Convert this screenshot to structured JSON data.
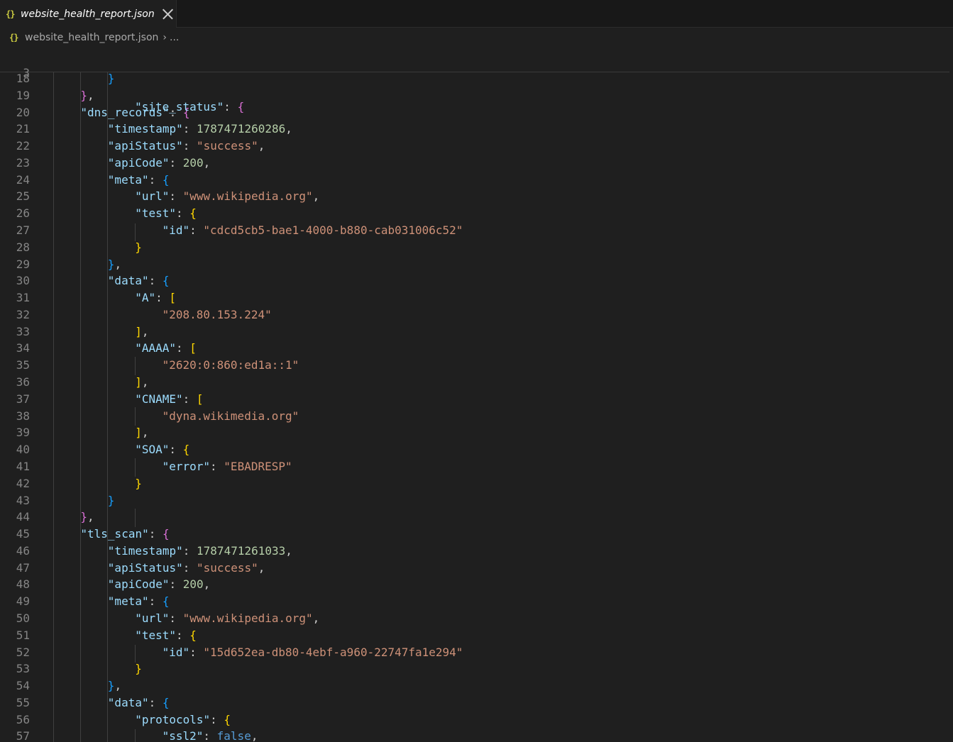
{
  "tab": {
    "filename": "website_health_report.json",
    "icon": "json-braces-icon"
  },
  "breadcrumb": {
    "file": "website_health_report.json",
    "sep": "›",
    "more": "..."
  },
  "sticky_line": {
    "number": "3",
    "key": "\"site_status\"",
    "brace": "{"
  },
  "colors": {
    "key": "#9cdcfe",
    "string": "#ce9178",
    "number": "#b5cea8",
    "keyword": "#569cd6",
    "bracket1": "#ffd700",
    "bracket2": "#da70d6",
    "bracket3": "#179fff"
  },
  "lines": [
    {
      "n": "18",
      "indent": 2,
      "tokens": [
        [
          "b3",
          "}"
        ]
      ]
    },
    {
      "n": "19",
      "indent": 1,
      "tokens": [
        [
          "b2",
          "}"
        ],
        [
          "p",
          ","
        ]
      ]
    },
    {
      "n": "20",
      "indent": 1,
      "tokens": [
        [
          "k",
          "\"dns_records\""
        ],
        [
          "p",
          ": "
        ],
        [
          "b2",
          "{"
        ]
      ]
    },
    {
      "n": "21",
      "indent": 2,
      "tokens": [
        [
          "k",
          "\"timestamp\""
        ],
        [
          "p",
          ": "
        ],
        [
          "n",
          "1787471260286"
        ],
        [
          "p",
          ","
        ]
      ]
    },
    {
      "n": "22",
      "indent": 2,
      "tokens": [
        [
          "k",
          "\"apiStatus\""
        ],
        [
          "p",
          ": "
        ],
        [
          "s",
          "\"success\""
        ],
        [
          "p",
          ","
        ]
      ]
    },
    {
      "n": "23",
      "indent": 2,
      "tokens": [
        [
          "k",
          "\"apiCode\""
        ],
        [
          "p",
          ": "
        ],
        [
          "n",
          "200"
        ],
        [
          "p",
          ","
        ]
      ]
    },
    {
      "n": "24",
      "indent": 2,
      "tokens": [
        [
          "k",
          "\"meta\""
        ],
        [
          "p",
          ": "
        ],
        [
          "b3",
          "{"
        ]
      ]
    },
    {
      "n": "25",
      "indent": 3,
      "tokens": [
        [
          "k",
          "\"url\""
        ],
        [
          "p",
          ": "
        ],
        [
          "s",
          "\"www.wikipedia.org\""
        ],
        [
          "p",
          ","
        ]
      ]
    },
    {
      "n": "26",
      "indent": 3,
      "tokens": [
        [
          "k",
          "\"test\""
        ],
        [
          "p",
          ": "
        ],
        [
          "b1",
          "{"
        ]
      ]
    },
    {
      "n": "27",
      "indent": 4,
      "tokens": [
        [
          "k",
          "\"id\""
        ],
        [
          "p",
          ": "
        ],
        [
          "s",
          "\"cdcd5cb5-bae1-4000-b880-cab031006c52\""
        ]
      ]
    },
    {
      "n": "28",
      "indent": 3,
      "tokens": [
        [
          "b1",
          "}"
        ]
      ]
    },
    {
      "n": "29",
      "indent": 2,
      "tokens": [
        [
          "b3",
          "}"
        ],
        [
          "p",
          ","
        ]
      ]
    },
    {
      "n": "30",
      "indent": 2,
      "tokens": [
        [
          "k",
          "\"data\""
        ],
        [
          "p",
          ": "
        ],
        [
          "b3",
          "{"
        ]
      ]
    },
    {
      "n": "31",
      "indent": 3,
      "tokens": [
        [
          "k",
          "\"A\""
        ],
        [
          "p",
          ": "
        ],
        [
          "b1",
          "["
        ]
      ]
    },
    {
      "n": "32",
      "indent": 4,
      "tokens": [
        [
          "s",
          "\"208.80.153.224\""
        ]
      ]
    },
    {
      "n": "33",
      "indent": 3,
      "tokens": [
        [
          "b1",
          "]"
        ],
        [
          "p",
          ","
        ]
      ]
    },
    {
      "n": "34",
      "indent": 3,
      "tokens": [
        [
          "k",
          "\"AAAA\""
        ],
        [
          "p",
          ": "
        ],
        [
          "b1",
          "["
        ]
      ]
    },
    {
      "n": "35",
      "indent": 4,
      "tokens": [
        [
          "s",
          "\"2620:0:860:ed1a::1\""
        ]
      ]
    },
    {
      "n": "36",
      "indent": 3,
      "tokens": [
        [
          "b1",
          "]"
        ],
        [
          "p",
          ","
        ]
      ]
    },
    {
      "n": "37",
      "indent": 3,
      "tokens": [
        [
          "k",
          "\"CNAME\""
        ],
        [
          "p",
          ": "
        ],
        [
          "b1",
          "["
        ]
      ]
    },
    {
      "n": "38",
      "indent": 4,
      "tokens": [
        [
          "s",
          "\"dyna.wikimedia.org\""
        ]
      ]
    },
    {
      "n": "39",
      "indent": 3,
      "tokens": [
        [
          "b1",
          "]"
        ],
        [
          "p",
          ","
        ]
      ]
    },
    {
      "n": "40",
      "indent": 3,
      "tokens": [
        [
          "k",
          "\"SOA\""
        ],
        [
          "p",
          ": "
        ],
        [
          "b1",
          "{"
        ]
      ]
    },
    {
      "n": "41",
      "indent": 4,
      "tokens": [
        [
          "k",
          "\"error\""
        ],
        [
          "p",
          ": "
        ],
        [
          "s",
          "\"EBADRESP\""
        ]
      ]
    },
    {
      "n": "42",
      "indent": 3,
      "tokens": [
        [
          "b1",
          "}"
        ]
      ]
    },
    {
      "n": "43",
      "indent": 2,
      "tokens": [
        [
          "b3",
          "}"
        ]
      ]
    },
    {
      "n": "44",
      "indent": 1,
      "tokens": [
        [
          "b2",
          "}"
        ],
        [
          "p",
          ","
        ]
      ]
    },
    {
      "n": "45",
      "indent": 1,
      "tokens": [
        [
          "k",
          "\"tls_scan\""
        ],
        [
          "p",
          ": "
        ],
        [
          "b2",
          "{"
        ]
      ]
    },
    {
      "n": "46",
      "indent": 2,
      "tokens": [
        [
          "k",
          "\"timestamp\""
        ],
        [
          "p",
          ": "
        ],
        [
          "n",
          "1787471261033"
        ],
        [
          "p",
          ","
        ]
      ]
    },
    {
      "n": "47",
      "indent": 2,
      "tokens": [
        [
          "k",
          "\"apiStatus\""
        ],
        [
          "p",
          ": "
        ],
        [
          "s",
          "\"success\""
        ],
        [
          "p",
          ","
        ]
      ]
    },
    {
      "n": "48",
      "indent": 2,
      "tokens": [
        [
          "k",
          "\"apiCode\""
        ],
        [
          "p",
          ": "
        ],
        [
          "n",
          "200"
        ],
        [
          "p",
          ","
        ]
      ]
    },
    {
      "n": "49",
      "indent": 2,
      "tokens": [
        [
          "k",
          "\"meta\""
        ],
        [
          "p",
          ": "
        ],
        [
          "b3",
          "{"
        ]
      ]
    },
    {
      "n": "50",
      "indent": 3,
      "tokens": [
        [
          "k",
          "\"url\""
        ],
        [
          "p",
          ": "
        ],
        [
          "s",
          "\"www.wikipedia.org\""
        ],
        [
          "p",
          ","
        ]
      ]
    },
    {
      "n": "51",
      "indent": 3,
      "tokens": [
        [
          "k",
          "\"test\""
        ],
        [
          "p",
          ": "
        ],
        [
          "b1",
          "{"
        ]
      ]
    },
    {
      "n": "52",
      "indent": 4,
      "tokens": [
        [
          "k",
          "\"id\""
        ],
        [
          "p",
          ": "
        ],
        [
          "s",
          "\"15d652ea-db80-4ebf-a960-22747fa1e294\""
        ]
      ]
    },
    {
      "n": "53",
      "indent": 3,
      "tokens": [
        [
          "b1",
          "}"
        ]
      ]
    },
    {
      "n": "54",
      "indent": 2,
      "tokens": [
        [
          "b3",
          "}"
        ],
        [
          "p",
          ","
        ]
      ]
    },
    {
      "n": "55",
      "indent": 2,
      "tokens": [
        [
          "k",
          "\"data\""
        ],
        [
          "p",
          ": "
        ],
        [
          "b3",
          "{"
        ]
      ]
    },
    {
      "n": "56",
      "indent": 3,
      "tokens": [
        [
          "k",
          "\"protocols\""
        ],
        [
          "p",
          ": "
        ],
        [
          "b1",
          "{"
        ]
      ]
    },
    {
      "n": "57",
      "indent": 4,
      "tokens": [
        [
          "k",
          "\"ssl2\""
        ],
        [
          "p",
          ": "
        ],
        [
          "kw",
          "false"
        ],
        [
          "p",
          ","
        ]
      ]
    }
  ]
}
